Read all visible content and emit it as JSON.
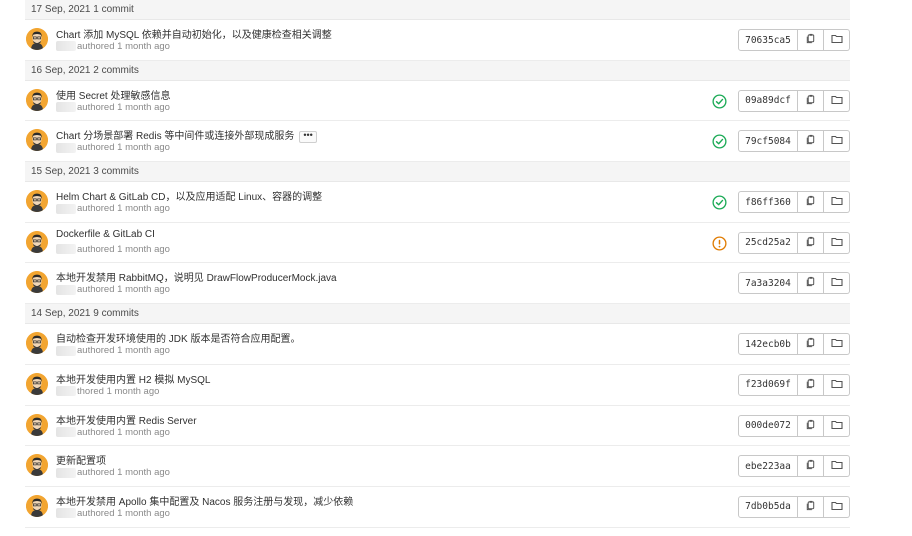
{
  "groups": [
    {
      "label": "17 Sep, 2021 1 commit",
      "commits": [
        {
          "title": "Chart 添加 MySQL 依赖并自动初始化，以及健康检查相关调整",
          "author_line": "authored 1 month ago",
          "status": "none",
          "sha": "70635ca5",
          "has_more": false
        }
      ]
    },
    {
      "label": "16 Sep, 2021 2 commits",
      "commits": [
        {
          "title": "使用 Secret 处理敏感信息",
          "author_line": "authored 1 month ago",
          "status": "success",
          "sha": "09a89dcf",
          "has_more": false
        },
        {
          "title": "Chart 分场景部署 Redis 等中间件或连接外部现成服务",
          "author_line": "authored 1 month ago",
          "status": "success",
          "sha": "79cf5084",
          "has_more": true
        }
      ]
    },
    {
      "label": "15 Sep, 2021 3 commits",
      "commits": [
        {
          "title": "Helm Chart & GitLab CD，以及应用适配 Linux、容器的调整",
          "author_line": "authored 1 month ago",
          "status": "success",
          "sha": "f86ff360",
          "has_more": false
        },
        {
          "title": "Dockerfile & GitLab CI",
          "author_line": "authored 1 month ago",
          "status": "warning",
          "sha": "25cd25a2",
          "has_more": false
        },
        {
          "title": "本地开发禁用 RabbitMQ，说明见 DrawFlowProducerMock.java",
          "author_line": "authored 1 month ago",
          "status": "none",
          "sha": "7a3a3204",
          "has_more": false
        }
      ]
    },
    {
      "label": "14 Sep, 2021 9 commits",
      "commits": [
        {
          "title": "自动检查开发环境使用的 JDK 版本是否符合应用配置。",
          "author_line": "authored 1 month ago",
          "status": "none",
          "sha": "142ecb0b",
          "has_more": false
        },
        {
          "title": "本地开发使用内置 H2 模拟 MySQL",
          "author_line": "thored 1 month ago",
          "status": "none",
          "sha": "f23d069f",
          "has_more": false
        },
        {
          "title": "本地开发使用内置 Redis Server",
          "author_line": "authored 1 month ago",
          "status": "none",
          "sha": "000de072",
          "has_more": false
        },
        {
          "title": "更新配置项",
          "author_line": "authored 1 month ago",
          "status": "none",
          "sha": "ebe223aa",
          "has_more": false
        },
        {
          "title": "本地开发禁用 Apollo 集中配置及 Nacos 服务注册与发现，减少依赖",
          "author_line": "authored 1 month ago",
          "status": "none",
          "sha": "7db0b5da",
          "has_more": false
        }
      ]
    }
  ],
  "more_label": "•••",
  "icons": {
    "avatar": "avatar-icon",
    "copy": "copy-icon",
    "browse": "folder-icon",
    "success": "check-circle-icon",
    "warning": "exclamation-circle-icon"
  },
  "colors": {
    "success": "#1aaa55",
    "warning": "#e07b00",
    "avatar_bg": "#f2a531",
    "header_bg": "#f5f5f5"
  }
}
